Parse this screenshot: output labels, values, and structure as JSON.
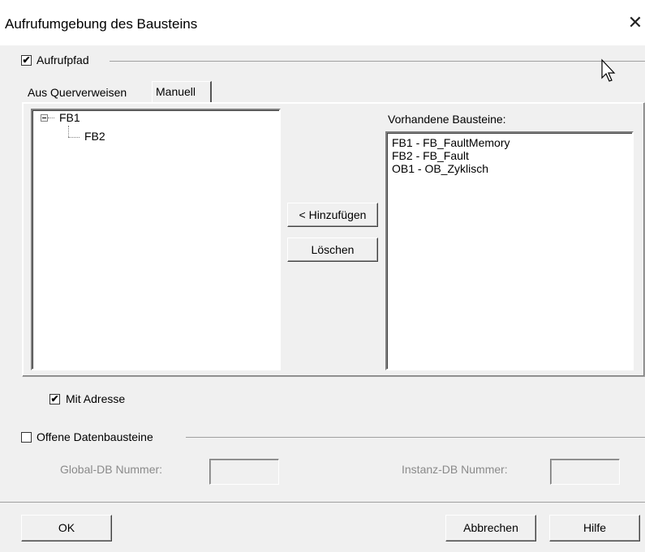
{
  "window": {
    "title": "Aufrufumgebung des Bausteins",
    "close_icon": "✕"
  },
  "aufrufpfad": {
    "label": "Aufrufpfad",
    "checked": true
  },
  "tabs": [
    {
      "label": "Aus Querverweisen",
      "active": false
    },
    {
      "label": "Manuell",
      "active": true
    }
  ],
  "tree": {
    "expander": "⊟",
    "root": "FB1",
    "child": "FB2"
  },
  "buttons": {
    "add": "< Hinzufügen",
    "delete": "Löschen",
    "ok": "OK",
    "cancel": "Abbrechen",
    "help": "Hilfe"
  },
  "available": {
    "label": "Vorhandene Bausteine:",
    "items": [
      "FB1 - FB_FaultMemory",
      "FB2 - FB_Fault",
      "OB1 - OB_Zyklisch"
    ]
  },
  "mit_adresse": {
    "label": "Mit Adresse",
    "checked": true
  },
  "offene": {
    "label": "Offene Datenbausteine",
    "checked": false,
    "global_label": "Global-DB Nummer:",
    "global_value": "",
    "instanz_label": "Instanz-DB Nummer:",
    "instanz_value": ""
  },
  "checkmark": "✔"
}
